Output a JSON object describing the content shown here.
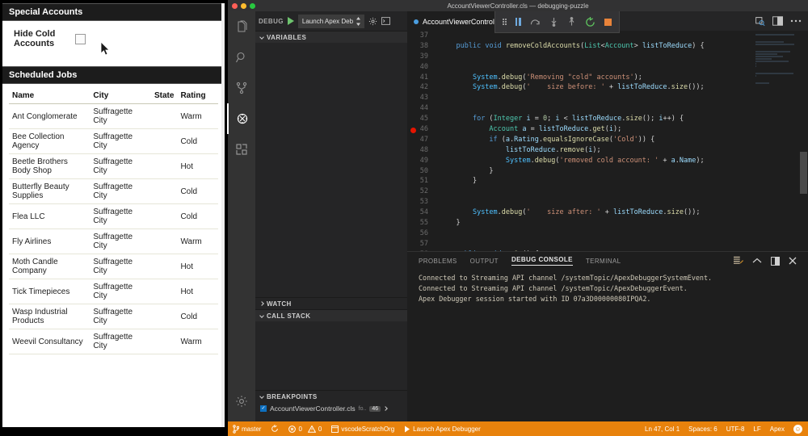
{
  "salesforce": {
    "special_accounts": {
      "header": "Special Accounts",
      "hide_cold_label": "Hide Cold Accounts",
      "checkbox_checked": false
    },
    "scheduled_jobs": {
      "header": "Scheduled Jobs",
      "columns": [
        "Name",
        "City",
        "State",
        "Rating"
      ],
      "rows": [
        {
          "name": "Ant Conglomerate",
          "city": "Suffragette City",
          "state": "",
          "rating": "Warm"
        },
        {
          "name": "Bee Collection Agency",
          "city": "Suffragette City",
          "state": "",
          "rating": "Cold"
        },
        {
          "name": "Beetle Brothers Body Shop",
          "city": "Suffragette City",
          "state": "",
          "rating": "Hot"
        },
        {
          "name": "Butterfly Beauty Supplies",
          "city": "Suffragette City",
          "state": "",
          "rating": "Cold"
        },
        {
          "name": "Flea LLC",
          "city": "Suffragette City",
          "state": "",
          "rating": "Cold"
        },
        {
          "name": "Fly Airlines",
          "city": "Suffragette City",
          "state": "",
          "rating": "Warm"
        },
        {
          "name": "Moth Candle Company",
          "city": "Suffragette City",
          "state": "",
          "rating": "Hot"
        },
        {
          "name": "Tick Timepieces",
          "city": "Suffragette City",
          "state": "",
          "rating": "Hot"
        },
        {
          "name": "Wasp Industrial Products",
          "city": "Suffragette City",
          "state": "",
          "rating": "Cold"
        },
        {
          "name": "Weevil Consultancy",
          "city": "Suffragette City",
          "state": "",
          "rating": "Warm"
        }
      ]
    }
  },
  "vscode": {
    "window_title": "AccountViewerController.cls — debugging-puzzle",
    "activity_bar": [
      {
        "name": "explorer-icon",
        "label": "Explorer"
      },
      {
        "name": "search-icon",
        "label": "Search"
      },
      {
        "name": "source-control-icon",
        "label": "Source Control"
      },
      {
        "name": "debug-icon",
        "label": "Debug"
      },
      {
        "name": "extensions-icon",
        "label": "Extensions"
      },
      {
        "name": "settings-gear-icon",
        "label": "Manage"
      }
    ],
    "debug_sidebar": {
      "title": "DEBUG",
      "config_value": "Launch Apex Deb",
      "sections": [
        {
          "label": "VARIABLES",
          "expanded": true
        },
        {
          "label": "WATCH",
          "expanded": false
        },
        {
          "label": "CALL STACK",
          "expanded": true
        },
        {
          "label": "BREAKPOINTS",
          "expanded": true
        }
      ],
      "breakpoints": [
        {
          "checked": true,
          "file": "AccountViewerController.cls",
          "folder": "fo..",
          "line": "46"
        }
      ]
    },
    "editor": {
      "tab_label": "AccountViewerController.cls",
      "tab_dirty": true,
      "debug_toolbar": [
        "grip",
        "pause-icon",
        "step-over-icon",
        "step-into-icon",
        "step-out-icon",
        "restart-icon",
        "stop-icon"
      ],
      "tab_actions": [
        "split-preview-icon",
        "split-editor-icon",
        "more-actions-icon"
      ],
      "breakpoint_line": 46,
      "first_visible_line": 37,
      "code_lines": [
        {
          "n": 37,
          "text": ""
        },
        {
          "n": 38,
          "text": "    public void removeColdAccounts(List<Account> listToReduce) {"
        },
        {
          "n": 39,
          "text": ""
        },
        {
          "n": 40,
          "text": ""
        },
        {
          "n": 41,
          "text": "        System.debug('Removing \"cold\" accounts');"
        },
        {
          "n": 42,
          "text": "        System.debug('    size before: ' + listToReduce.size());"
        },
        {
          "n": 43,
          "text": ""
        },
        {
          "n": 44,
          "text": ""
        },
        {
          "n": 45,
          "text": "        for (Integer i = 0; i < listToReduce.size(); i++) {"
        },
        {
          "n": 46,
          "text": "            Account a = listToReduce.get(i);"
        },
        {
          "n": 47,
          "text": "            if (a.Rating.equalsIgnoreCase('Cold')) {"
        },
        {
          "n": 48,
          "text": "                listToReduce.remove(i);"
        },
        {
          "n": 49,
          "text": "                System.debug('removed cold account: ' + a.Name);"
        },
        {
          "n": 50,
          "text": "            }"
        },
        {
          "n": 51,
          "text": "        }"
        },
        {
          "n": 52,
          "text": ""
        },
        {
          "n": 53,
          "text": ""
        },
        {
          "n": 54,
          "text": "        System.debug('    size after: ' + listToReduce.size());"
        },
        {
          "n": 55,
          "text": "    }"
        },
        {
          "n": 56,
          "text": ""
        },
        {
          "n": 57,
          "text": ""
        },
        {
          "n": 58,
          "text": "    public void noOp() {"
        }
      ]
    },
    "panel": {
      "tabs": [
        {
          "label": "PROBLEMS",
          "active": false
        },
        {
          "label": "OUTPUT",
          "active": false
        },
        {
          "label": "DEBUG CONSOLE",
          "active": true
        },
        {
          "label": "TERMINAL",
          "active": false
        }
      ],
      "actions": [
        "clear-console-icon",
        "chevron-up-icon",
        "maximize-panel-icon",
        "close-panel-icon"
      ],
      "console_lines": [
        "Connected to Streaming API channel /systemTopic/ApexDebuggerSystemEvent.",
        "Connected to Streaming API channel /systemTopic/ApexDebuggerEvent.",
        "Apex Debugger session started with ID 07a3D00000080IPQA2."
      ]
    },
    "status_bar": {
      "background": "#e8820c",
      "left": [
        {
          "name": "git-branch",
          "icon": "branch-icon",
          "label": "master"
        },
        {
          "name": "sync",
          "icon": "sync-icon",
          "label": ""
        },
        {
          "name": "problems",
          "icon": "error-warning-icon",
          "label": "0  0"
        },
        {
          "name": "org",
          "icon": "browser-icon",
          "label": "vscodeScratchOrg"
        },
        {
          "name": "launch-debugger",
          "icon": "play-icon",
          "label": "Launch Apex Debugger"
        }
      ],
      "right": [
        {
          "name": "cursor-position",
          "label": "Ln 47, Col 1"
        },
        {
          "name": "indentation",
          "label": "Spaces: 6"
        },
        {
          "name": "encoding",
          "label": "UTF-8"
        },
        {
          "name": "eol",
          "label": "LF"
        },
        {
          "name": "language-mode",
          "label": "Apex"
        },
        {
          "name": "feedback-smiley",
          "label": ""
        }
      ],
      "errors_count": "0",
      "warnings_count": "0"
    }
  }
}
